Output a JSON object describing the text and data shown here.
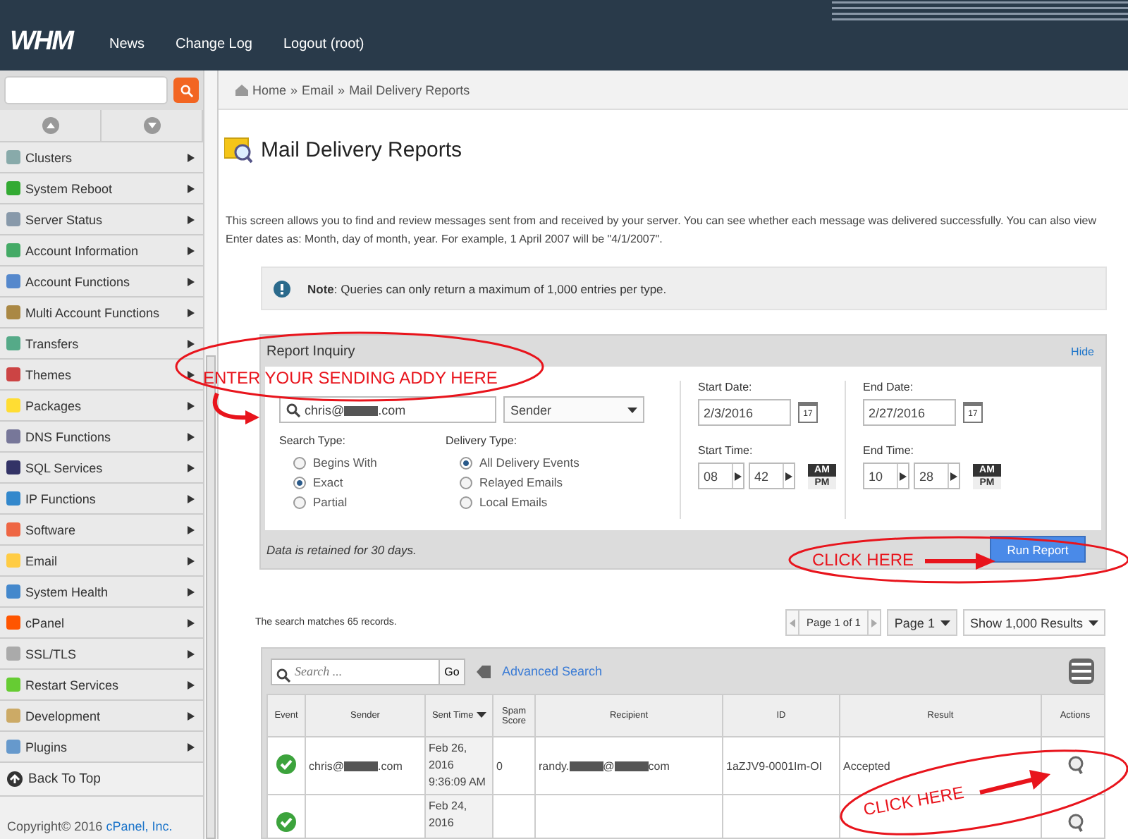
{
  "topbar": {
    "logo": "WHM",
    "nav": [
      {
        "label": "News"
      },
      {
        "label": "Change Log"
      },
      {
        "label": "Logout (root)"
      }
    ]
  },
  "sidebar": {
    "items": [
      {
        "label": "Clusters"
      },
      {
        "label": "System Reboot"
      },
      {
        "label": "Server Status"
      },
      {
        "label": "Account Information"
      },
      {
        "label": "Account Functions"
      },
      {
        "label": "Multi Account Functions"
      },
      {
        "label": "Transfers"
      },
      {
        "label": "Themes"
      },
      {
        "label": "Packages"
      },
      {
        "label": "DNS Functions"
      },
      {
        "label": "SQL Services"
      },
      {
        "label": "IP Functions"
      },
      {
        "label": "Software"
      },
      {
        "label": "Email"
      },
      {
        "label": "System Health"
      },
      {
        "label": "cPanel"
      },
      {
        "label": "SSL/TLS"
      },
      {
        "label": "Restart Services"
      },
      {
        "label": "Development"
      },
      {
        "label": "Plugins"
      }
    ],
    "back_to_top": "Back To Top",
    "copyright": "Copyright© 2016",
    "company_link": "cPanel, Inc."
  },
  "breadcrumb": [
    "Home",
    "»",
    "Email",
    "»",
    "Mail Delivery Reports"
  ],
  "title": "Mail Delivery Reports",
  "description": [
    "This screen allows you to find and review messages sent from and received by your server. You can see whether each message was delivered successfully. You can also view",
    "Enter dates as: Month, day of month, year. For example, 1 April 2007 will be \"4/1/2007\"."
  ],
  "note": "**Note**: Queries can only return a maximum of 1,000 entries per type.",
  "inquiry": {
    "title": "Report Inquiry",
    "hide": "Hide",
    "address_parts": [
      "chris@",
      ".com"
    ],
    "field_type": "Sender",
    "search_type": {
      "label": "Search Type:",
      "options": [
        {
          "label": "Begins With",
          "selected": false
        },
        {
          "label": "Exact",
          "selected": true
        },
        {
          "label": "Partial",
          "selected": false
        }
      ]
    },
    "delivery_type": {
      "label": "Delivery Type:",
      "options": [
        {
          "label": "All Delivery Events",
          "selected": true
        },
        {
          "label": "Relayed Emails",
          "selected": false
        },
        {
          "label": "Local Emails",
          "selected": false
        }
      ]
    },
    "ranges": [
      {
        "date_label": "Start Date:",
        "date": "2/3/2016",
        "calendar_day": "17",
        "time_label": "Start Time:",
        "hour": "08",
        "minute": "42",
        "am": "AM",
        "pm": "PM",
        "am_selected": true
      },
      {
        "date_label": "End Date:",
        "date": "2/27/2016",
        "calendar_day": "17",
        "time_label": "End Time:",
        "hour": "10",
        "minute": "28",
        "am": "AM",
        "pm": "PM",
        "am_selected": true
      }
    ],
    "retention": "Data is retained for 30 days.",
    "run_button": "Run Report"
  },
  "results": {
    "summary": "The search matches 65 records.",
    "pager": "Page 1 of 1",
    "page_select": "Page 1",
    "size_select": "Show 1,000 Results",
    "search_placeholder": "Search ...",
    "go": "Go",
    "advanced": "Advanced Search",
    "columns": [
      "Event",
      "Sender",
      "Sent Time",
      "Spam Score",
      "Recipient",
      "ID",
      "Result",
      "Actions"
    ],
    "rows": [
      {
        "delivered": true,
        "sender_parts": [
          "chris@",
          ".com"
        ],
        "sent_time": [
          "Feb 26,",
          "2016",
          "9:36:09 AM"
        ],
        "spam_score": "0",
        "recipient_parts": [
          "randy.",
          "@",
          "com"
        ],
        "id": "1aZJV9-0001Im-OI",
        "result": "Accepted"
      },
      {
        "delivered": true,
        "sent_time": [
          "Feb 24,",
          "2016"
        ]
      }
    ]
  },
  "annotations": [
    {
      "text": "ENTER YOUR SENDING ADDY HERE"
    },
    {
      "text": "CLICK HERE"
    },
    {
      "text": "CLICK HERE"
    }
  ]
}
